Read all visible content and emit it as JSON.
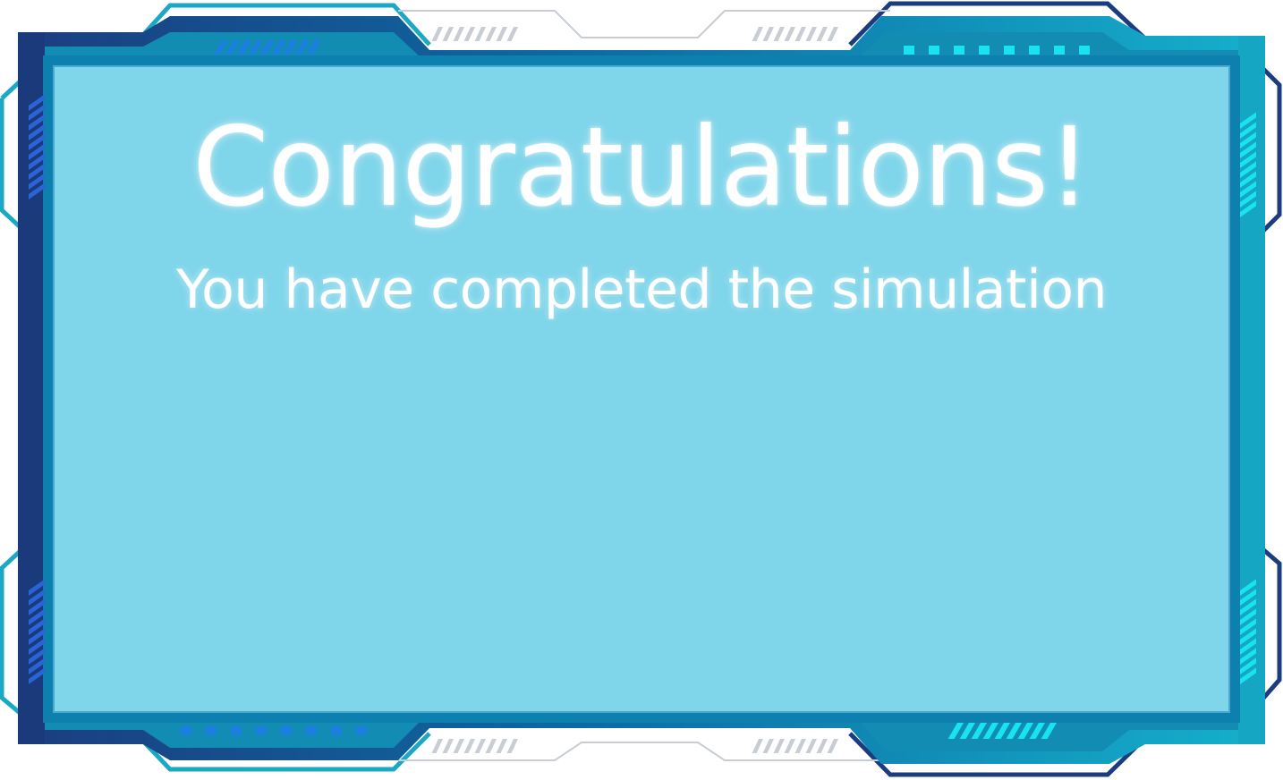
{
  "message": {
    "title": "Congratulations!",
    "subtitle": "You have completed the simulation"
  },
  "theme": {
    "panel_fill": "#7fd5ea",
    "frame_dark": "#1a3a7a",
    "frame_mid": "#0f6aa0",
    "frame_teal": "#1aa8c4",
    "accent_cyan": "#19e3f0",
    "accent_blue": "#1c7fe0",
    "title_color": "#ffffff"
  },
  "decorations": {
    "top_left": "hatch-stripes-icon",
    "top_right": "dot-row-icon",
    "bottom_left": "dot-row-icon",
    "bottom_right": "hatch-stripes-icon",
    "left_side": "vertical-stripes-icon",
    "right_side": "vertical-stripes-icon"
  }
}
